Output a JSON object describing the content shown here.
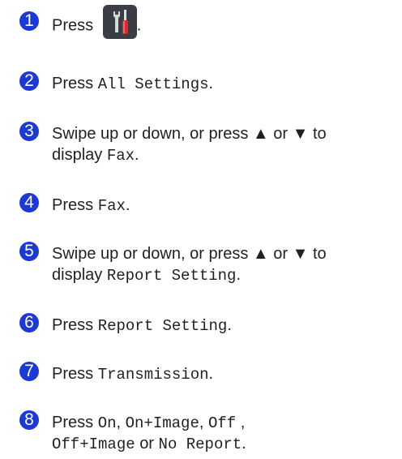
{
  "steps": [
    {
      "number": "1",
      "press": "Press",
      "icon": "settings-tools-icon",
      "after": "."
    },
    {
      "number": "2",
      "press": "Press",
      "mono": "All Settings",
      "after": "."
    },
    {
      "number": "3",
      "line1": "Swipe up or down, or press ▲ or ▼ to",
      "display": "display",
      "mono": "Fax",
      "after": "."
    },
    {
      "number": "4",
      "press": "Press",
      "mono": "Fax",
      "after": "."
    },
    {
      "number": "5",
      "line1": "Swipe up or down, or press ▲ or ▼ to",
      "display": "display",
      "mono": "Report Setting",
      "after": "."
    },
    {
      "number": "6",
      "press": "Press",
      "mono": "Report Setting",
      "after": "."
    },
    {
      "number": "7",
      "press": "Press",
      "mono": "Transmission",
      "after": "."
    },
    {
      "number": "8",
      "press": "Press",
      "opt1": "On",
      "comma1": ",",
      "opt2": "On+Image",
      "comma2": ",",
      "opt3": "Off",
      "comma3": " ,",
      "opt4": "Off+Image",
      "or": "or",
      "opt5": "No Report",
      "after": "."
    }
  ],
  "colors": {
    "badge": "#1c39d6",
    "text": "#231f20",
    "icon_bg": "#3a3d43"
  }
}
